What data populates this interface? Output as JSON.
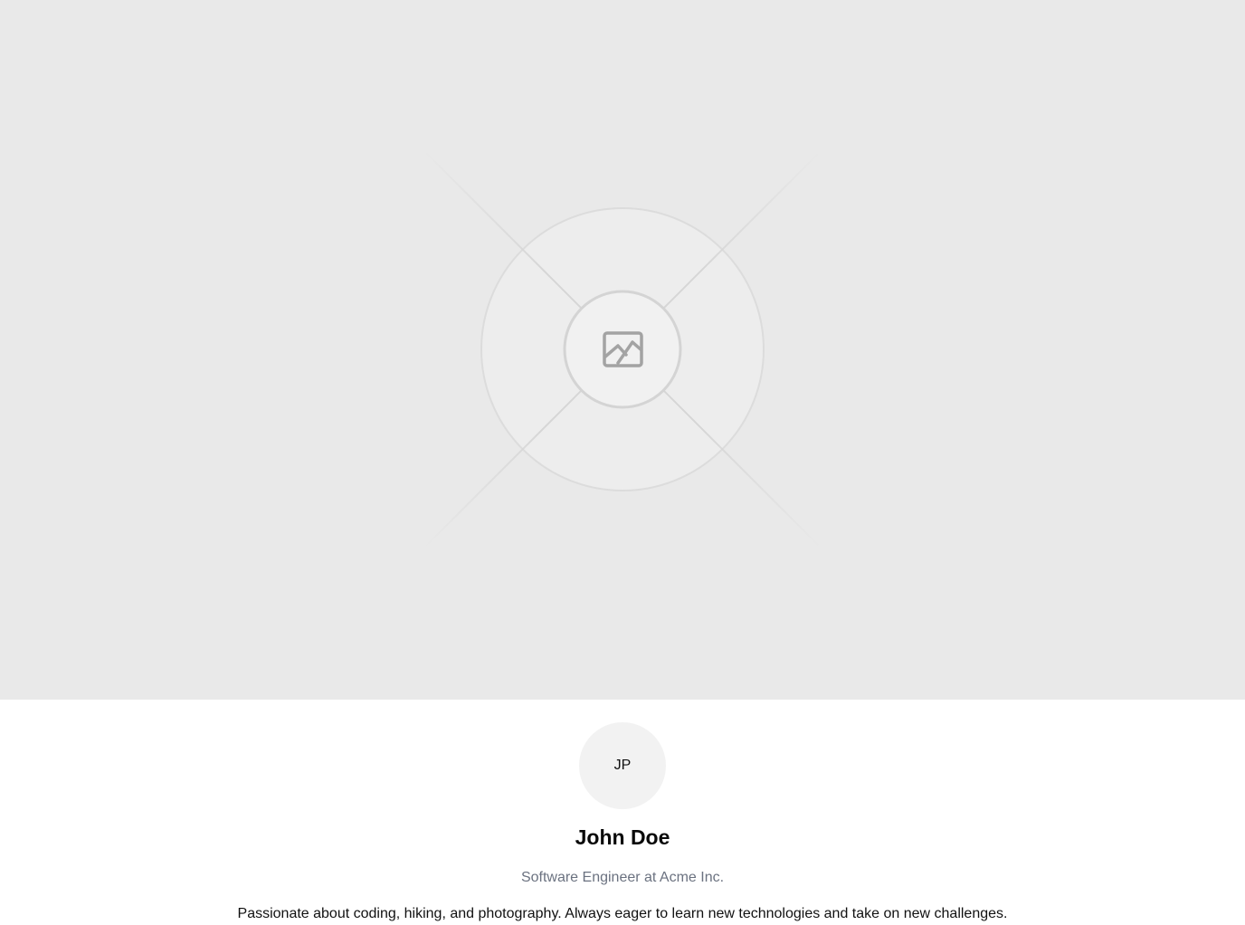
{
  "cover": {
    "placeholder_icon": "image-placeholder-icon",
    "background_color": "#e9e9e9"
  },
  "profile": {
    "avatar_initials": "JP",
    "name": "John Doe",
    "headline": "Software Engineer at Acme Inc.",
    "bio": "Passionate about coding, hiking, and photography. Always eager to learn new technologies and take on new challenges."
  }
}
